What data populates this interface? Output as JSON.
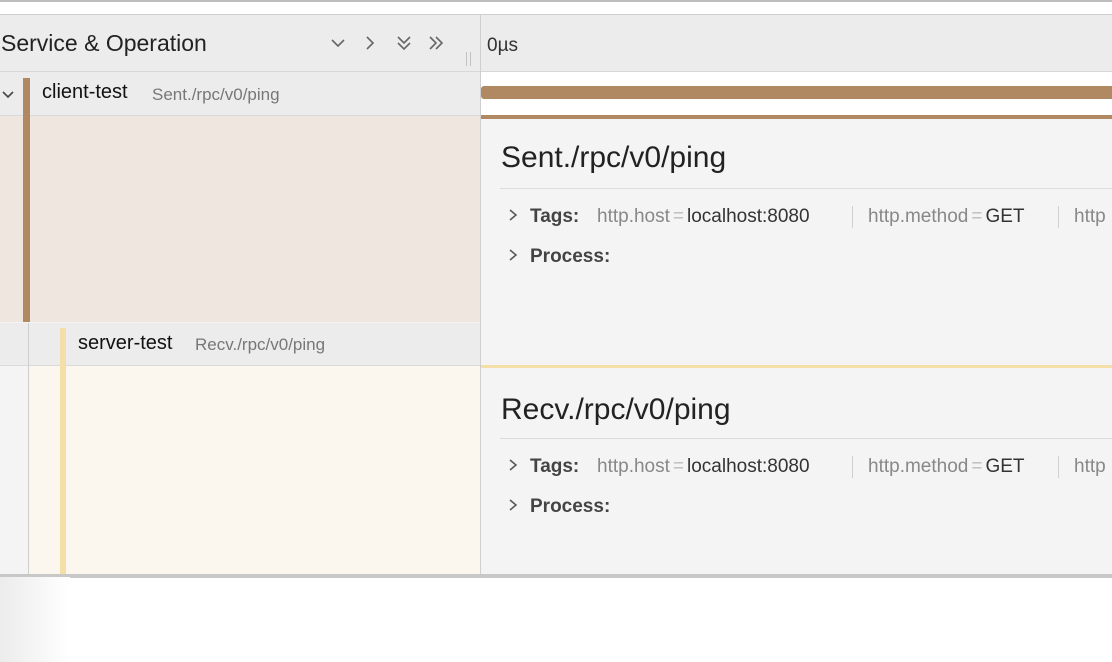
{
  "header": {
    "title": "Service & Operation",
    "tick_label": "0µs",
    "buttons": [
      "collapse-one-icon",
      "expand-one-icon",
      "expand-all-icon",
      "collapse-all-icon"
    ]
  },
  "spans": [
    {
      "service": "client-test",
      "operation": "Sent./rpc/v0/ping",
      "color": "#b08963",
      "detail": {
        "title": "Sent./rpc/v0/ping",
        "tags_label": "Tags:",
        "process_label": "Process:",
        "tags": [
          {
            "key": "http.host",
            "value": "localhost:8080"
          },
          {
            "key": "http.method",
            "value": "GET"
          },
          {
            "key": "http",
            "value": ""
          }
        ]
      }
    },
    {
      "service": "server-test",
      "operation": "Recv./rpc/v0/ping",
      "color": "#f5dfa8",
      "detail": {
        "title": "Recv./rpc/v0/ping",
        "tags_label": "Tags:",
        "process_label": "Process:",
        "tags": [
          {
            "key": "http.host",
            "value": "localhost:8080"
          },
          {
            "key": "http.method",
            "value": "GET"
          },
          {
            "key": "http",
            "value": ""
          }
        ]
      }
    }
  ],
  "colors": {
    "client_accent": "#b08963",
    "server_accent": "#f5dfa8",
    "client_detail_bg": "#efe6e0",
    "server_detail_bg": "#fbf7ee"
  }
}
